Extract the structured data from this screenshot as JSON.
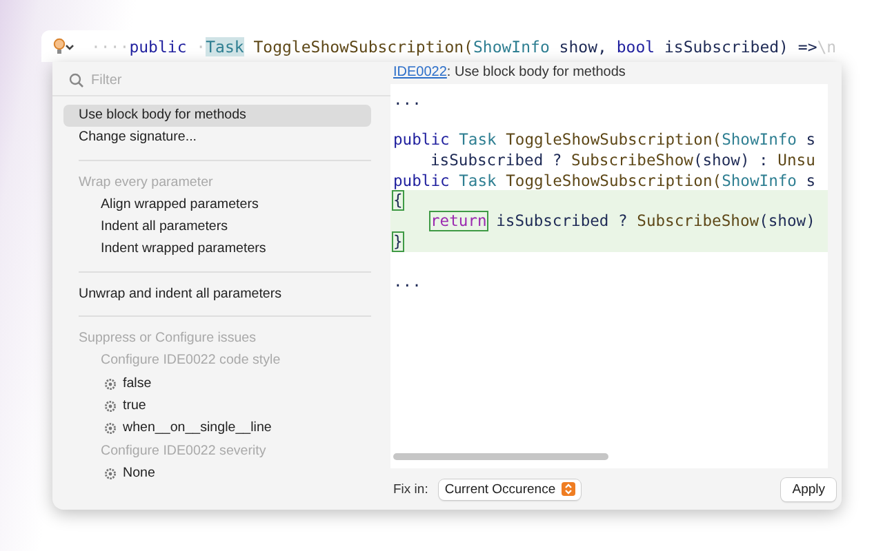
{
  "editor": {
    "line": [
      {
        "t": "····",
        "kind": "ws"
      },
      {
        "t": "public",
        "kind": "keyword"
      },
      {
        "t": " ·",
        "kind": "ws"
      },
      {
        "t": "Task",
        "kind": "type",
        "highlight": true
      },
      {
        "t": " ToggleShowSubscription(",
        "kind": "method"
      },
      {
        "t": "ShowInfo",
        "kind": "type"
      },
      {
        "t": " show, ",
        "kind": "plain"
      },
      {
        "t": "bool",
        "kind": "keyword"
      },
      {
        "t": " isSubscribed) =>",
        "kind": "plain"
      },
      {
        "t": "\\n",
        "kind": "ws"
      }
    ]
  },
  "filter": {
    "placeholder": "Filter"
  },
  "groups": [
    {
      "items": [
        {
          "kind": "action",
          "label": "Use block body for methods",
          "selected": true
        },
        {
          "kind": "action",
          "label": "Change signature...",
          "selected": false
        }
      ]
    },
    {
      "items": [
        {
          "kind": "header",
          "label": "Wrap every parameter"
        },
        {
          "kind": "sub",
          "label": "Align wrapped parameters"
        },
        {
          "kind": "sub",
          "label": "Indent all parameters"
        },
        {
          "kind": "sub",
          "label": "Indent wrapped parameters"
        }
      ]
    },
    {
      "items": [
        {
          "kind": "action",
          "label": "Unwrap and indent all parameters",
          "selected": false
        }
      ]
    },
    {
      "items": [
        {
          "kind": "header",
          "label": "Suppress or Configure issues"
        },
        {
          "kind": "subheader",
          "label": "Configure IDE0022 code style"
        },
        {
          "kind": "option",
          "label": "false"
        },
        {
          "kind": "option",
          "label": "true"
        },
        {
          "kind": "option",
          "label": "when__on__single__line"
        },
        {
          "kind": "subheader",
          "label": "Configure IDE0022 severity"
        },
        {
          "kind": "option",
          "label": "None"
        }
      ]
    }
  ],
  "preview": {
    "rule_link": "IDE0022",
    "rule_text": ": Use block body for methods",
    "lines": [
      {
        "kind": "context",
        "indented": false,
        "tokens": [
          {
            "t": "...",
            "kind": "plain"
          }
        ]
      },
      {
        "kind": "context"
      },
      {
        "kind": "context",
        "indented": false,
        "tokens": [
          {
            "t": "public ",
            "kind": "keyword"
          },
          {
            "t": "Task",
            "kind": "type"
          },
          {
            "t": " ToggleShowSubscription(",
            "kind": "method"
          },
          {
            "t": "ShowInfo",
            "kind": "type"
          },
          {
            "t": " s",
            "kind": "plain"
          }
        ]
      },
      {
        "kind": "context",
        "indented": true,
        "tokens": [
          {
            "t": "isSubscribed ? ",
            "kind": "plain"
          },
          {
            "t": "SubscribeShow",
            "kind": "method"
          },
          {
            "t": "(show) : ",
            "kind": "plain"
          },
          {
            "t": "Unsu",
            "kind": "method"
          }
        ]
      },
      {
        "kind": "context",
        "indented": false,
        "tokens": [
          {
            "t": "public ",
            "kind": "keyword"
          },
          {
            "t": "Task",
            "kind": "type"
          },
          {
            "t": " ToggleShowSubscription(",
            "kind": "method"
          },
          {
            "t": "ShowInfo",
            "kind": "type"
          },
          {
            "t": " s",
            "kind": "plain"
          }
        ]
      },
      {
        "kind": "added",
        "indented": false,
        "tokens": [
          {
            "t": "{",
            "kind": "plain",
            "boxed": true
          }
        ]
      },
      {
        "kind": "added",
        "indented": true,
        "tokens": [
          {
            "t": "return",
            "kind": "control",
            "boxed": true
          },
          {
            "t": " isSubscribed ? ",
            "kind": "plain"
          },
          {
            "t": "SubscribeShow",
            "kind": "method"
          },
          {
            "t": "(show)",
            "kind": "plain"
          }
        ]
      },
      {
        "kind": "added",
        "indented": false,
        "tokens": [
          {
            "t": "}",
            "kind": "plain",
            "boxed": true
          }
        ]
      },
      {
        "kind": "context"
      },
      {
        "kind": "context",
        "indented": false,
        "tokens": [
          {
            "t": "...",
            "kind": "plain"
          }
        ]
      }
    ]
  },
  "footer": {
    "label": "Fix in:",
    "scope": "Current Occurence",
    "apply": "Apply"
  }
}
